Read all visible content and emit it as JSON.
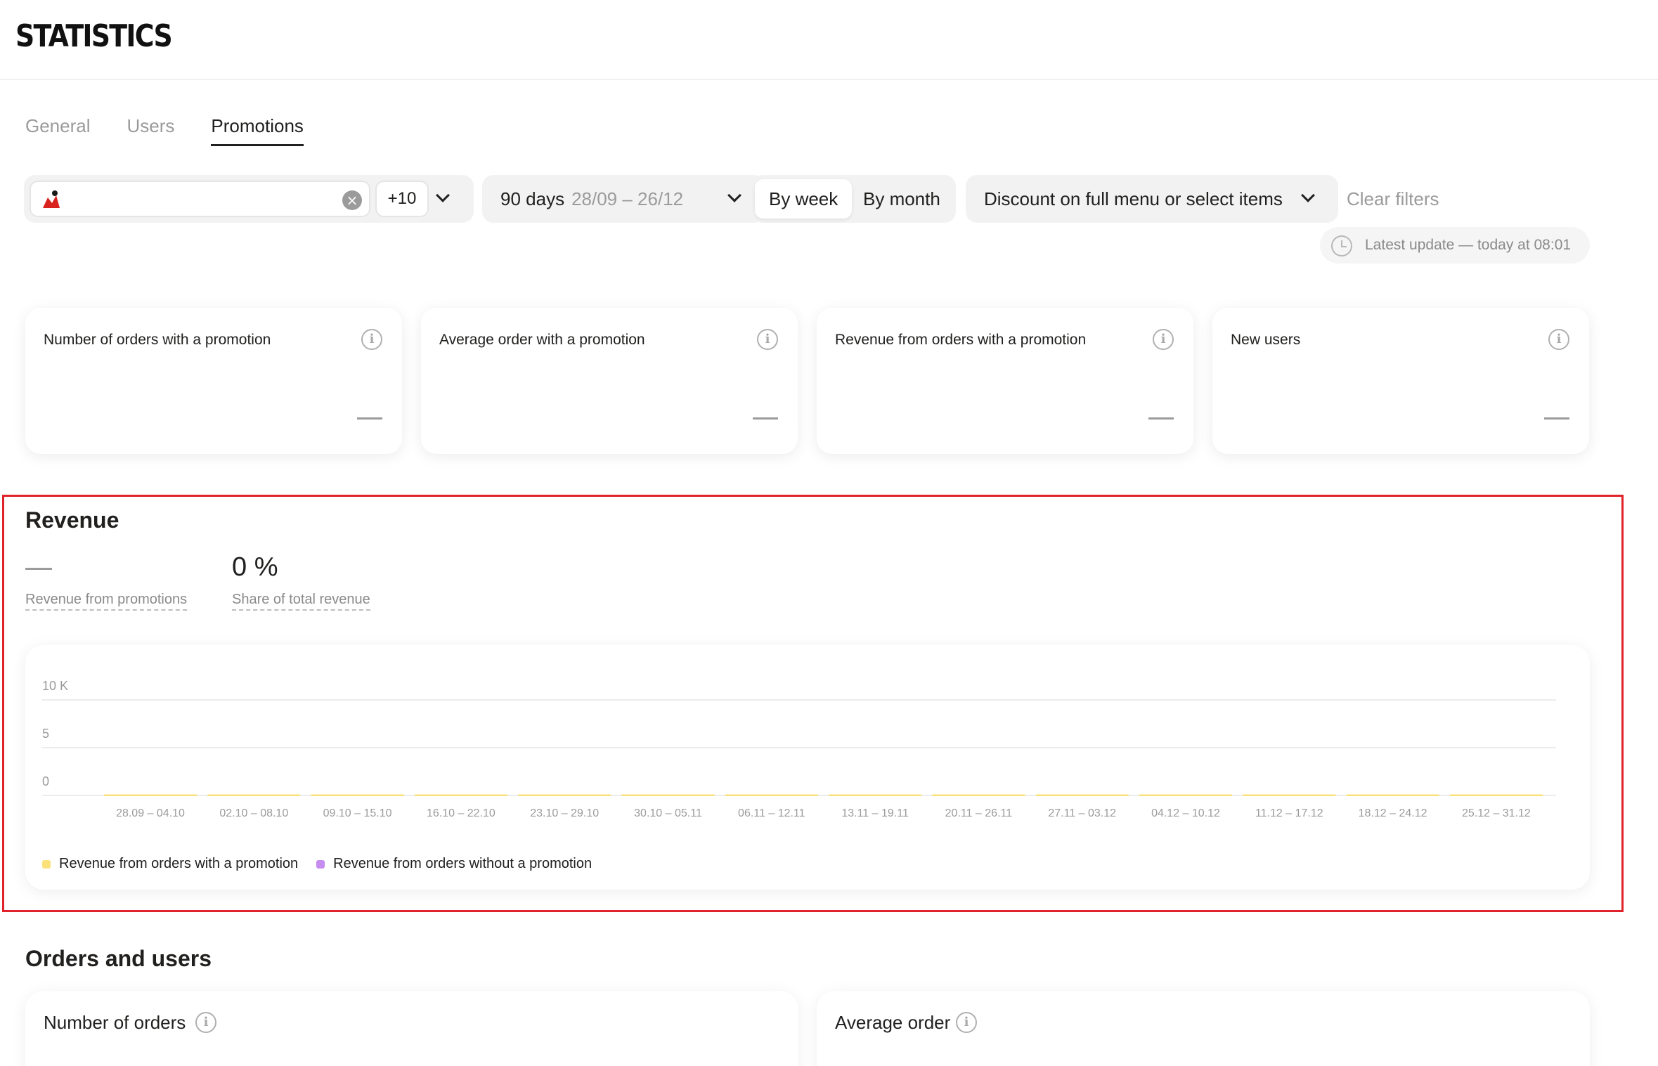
{
  "header": {
    "logo": "STATISTICS"
  },
  "tabs": [
    {
      "label": "General",
      "active": false
    },
    {
      "label": "Users",
      "active": false
    },
    {
      "label": "Promotions",
      "active": true
    }
  ],
  "filters": {
    "restaurant_count_chip": "+10",
    "period_days": "90 days",
    "period_range": "28/09 – 26/12",
    "grouping": [
      {
        "label": "By week",
        "active": true
      },
      {
        "label": "By month",
        "active": false
      }
    ],
    "promo_type": "Discount on full menu or select items",
    "clear_filters": "Clear filters"
  },
  "last_update": "Latest update — today at 08:01",
  "metrics": [
    {
      "title": "Number of orders with a promotion",
      "value": "—"
    },
    {
      "title": "Average order with a promotion",
      "value": "—"
    },
    {
      "title": "Revenue from orders with a promotion",
      "value": "—"
    },
    {
      "title": "New users",
      "value": "—"
    }
  ],
  "revenue": {
    "title": "Revenue",
    "from_promotions_value": "—",
    "from_promotions_label": "Revenue from promotions",
    "share_value": "0 %",
    "share_label": "Share of total revenue"
  },
  "colors": {
    "with_promotion": "#fbe17a",
    "without_promotion": "#c58df0",
    "highlight": "#e0232b"
  },
  "chart_data": {
    "type": "bar",
    "categories": [
      "28.09 – 04.10",
      "02.10 – 08.10",
      "09.10 – 15.10",
      "16.10 – 22.10",
      "23.10 – 29.10",
      "30.10 – 05.11",
      "06.11 – 12.11",
      "13.11 – 19.11",
      "20.11 – 26.11",
      "27.11 – 03.12",
      "04.12 – 10.12",
      "11.12 – 17.12",
      "18.12 – 24.12",
      "25.12 – 31.12"
    ],
    "series": [
      {
        "name": "Revenue from orders with a promotion",
        "values": [
          0,
          0,
          0,
          0,
          0,
          0,
          0,
          0,
          0,
          0,
          0,
          0,
          0,
          0
        ]
      },
      {
        "name": "Revenue from orders without a promotion",
        "values": [
          0,
          0,
          0,
          0,
          0,
          0,
          0,
          0,
          0,
          0,
          0,
          0,
          0,
          0
        ]
      }
    ],
    "y_ticks": [
      "0",
      "5",
      "10 K"
    ],
    "ylim": [
      0,
      10
    ],
    "grid": true,
    "legend": "bottom-left"
  },
  "orders_users": {
    "title": "Orders and users",
    "cards": [
      {
        "title": "Number of orders"
      },
      {
        "title": "Average order"
      }
    ]
  }
}
